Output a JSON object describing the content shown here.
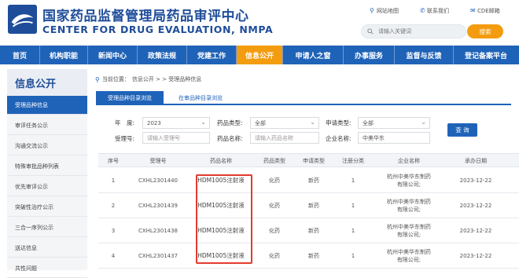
{
  "header": {
    "title_cn": "国家药品监督管理局药品审评中心",
    "title_en": "CENTER FOR DRUG EVALUATION, NMPA",
    "links": [
      "网站地图",
      "联系我们",
      "CDE邮箱"
    ],
    "search": {
      "placeholder": "请输入关键词",
      "button": "搜索"
    }
  },
  "nav": {
    "items": [
      "首页",
      "机构职能",
      "新闻中心",
      "政策法规",
      "党建工作",
      "信息公开",
      "申请人之窗",
      "办事服务",
      "监督与反馈",
      "登记备案平台"
    ],
    "active": "信息公开"
  },
  "sidebar": {
    "title": "信息公开",
    "items": [
      "受理品种信息",
      "审评任务公示",
      "沟通交流公示",
      "特殊审批品种列表",
      "优先审评公示",
      "突破性治疗公示",
      "三合一序列公示",
      "送达信息",
      "共性问题"
    ]
  },
  "breadcrumb": {
    "label": "当前位置：",
    "path": "信息公开 > > 受理品种信息"
  },
  "tabs": [
    "受理品种目录浏览",
    "在审品种目录浏览"
  ],
  "filter": {
    "year_label": "年　度:",
    "year_value": "2023",
    "drug_type_label": "药品类型:",
    "drug_type_value": "全部",
    "apply_type_label": "申请类型:",
    "apply_type_value": "全部",
    "accept_no_label": "受理号:",
    "accept_no_placeholder": "请输入受理号",
    "drug_name_label": "药品名称:",
    "drug_name_placeholder": "请输入药品名称",
    "company_label": "企业名称:",
    "company_value": "中美华东",
    "query_button": "查 询"
  },
  "table": {
    "columns": [
      "序号",
      "受理号",
      "药品名称",
      "药品类型",
      "申请类型",
      "注册分类",
      "企业名称",
      "承办日期"
    ],
    "rows": [
      [
        "1",
        "CXHL2301440",
        "HDM1005注射液",
        "化药",
        "新药",
        "1",
        "杭州中美华东制药有限公司;",
        "2023-12-22"
      ],
      [
        "2",
        "CXHL2301439",
        "HDM1005注射液",
        "化药",
        "新药",
        "1",
        "杭州中美华东制药有限公司;",
        "2023-12-22"
      ],
      [
        "3",
        "CXHL2301438",
        "HDM1005注射液",
        "化药",
        "新药",
        "1",
        "杭州中美华东制药有限公司;",
        "2023-12-22"
      ],
      [
        "4",
        "CXHL2301437",
        "HDM1005注射液",
        "化药",
        "新药",
        "1",
        "杭州中美华东制药有限公司;",
        "2023-12-22"
      ]
    ]
  },
  "colors": {
    "primary": "#1f63b8",
    "accent": "#f39c0f",
    "highlight": "#e23b2e",
    "title": "#1f4d9a"
  }
}
